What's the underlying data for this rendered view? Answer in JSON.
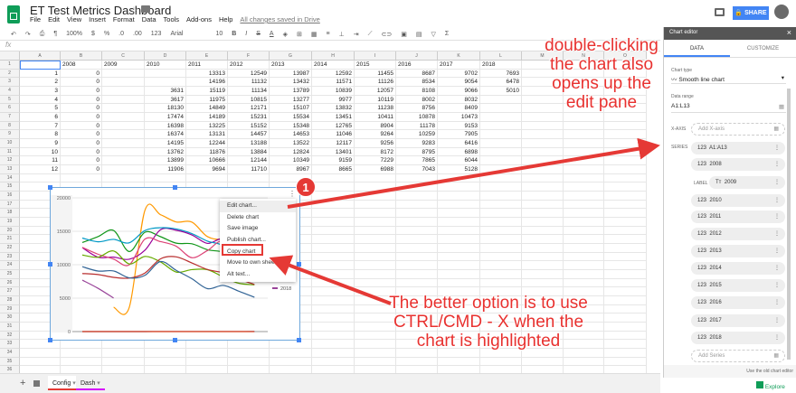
{
  "app": {
    "title": "ET Test Metrics Dashboard",
    "menus": [
      "File",
      "Edit",
      "View",
      "Insert",
      "Format",
      "Data",
      "Tools",
      "Add-ons",
      "Help"
    ],
    "save_status": "All changes saved in Drive",
    "share_label": "SHARE"
  },
  "toolbar": {
    "zoom": "100%",
    "currency": "$",
    "percent": "%",
    "dec_less": ".0",
    "dec_more": ".00",
    "format": "123",
    "font": "Arial",
    "size": "10",
    "bold": "B",
    "italic": "I",
    "strike": "S",
    "text_color": "A",
    "fx": "fx"
  },
  "columns": [
    "A",
    "B",
    "C",
    "D",
    "E",
    "F",
    "G",
    "H",
    "I",
    "J",
    "K",
    "L",
    "M",
    "N",
    "O"
  ],
  "rows": [
    [
      "",
      "2008",
      "2009",
      "2010",
      "2011",
      "2012",
      "2013",
      "2014",
      "2015",
      "2016",
      "2017",
      "2018"
    ],
    [
      "1",
      "0",
      "",
      "",
      "13313",
      "12549",
      "13987",
      "12592",
      "11455",
      "8687",
      "9702",
      "7693"
    ],
    [
      "2",
      "0",
      "",
      "",
      "14196",
      "11132",
      "13432",
      "11571",
      "11126",
      "8534",
      "9054",
      "6478"
    ],
    [
      "3",
      "0",
      "",
      "3631",
      "15119",
      "11134",
      "13789",
      "10839",
      "12057",
      "8108",
      "9066",
      "5010"
    ],
    [
      "4",
      "0",
      "",
      "3617",
      "11975",
      "10815",
      "13277",
      "9977",
      "10119",
      "8002",
      "8032",
      ""
    ],
    [
      "5",
      "0",
      "",
      "18130",
      "14849",
      "12171",
      "15107",
      "13832",
      "11238",
      "8756",
      "8409",
      ""
    ],
    [
      "6",
      "0",
      "",
      "17474",
      "14189",
      "15231",
      "15534",
      "13451",
      "10411",
      "10878",
      "10473",
      ""
    ],
    [
      "7",
      "0",
      "",
      "16398",
      "13225",
      "15152",
      "15348",
      "12765",
      "8904",
      "11178",
      "9153",
      ""
    ],
    [
      "8",
      "0",
      "",
      "16374",
      "13131",
      "14457",
      "14653",
      "11046",
      "9264",
      "10259",
      "7905",
      ""
    ],
    [
      "9",
      "0",
      "",
      "14195",
      "12244",
      "13188",
      "13522",
      "12117",
      "9256",
      "9283",
      "6416",
      ""
    ],
    [
      "10",
      "0",
      "",
      "13762",
      "11876",
      "13884",
      "12824",
      "13401",
      "8172",
      "8795",
      "6898",
      ""
    ],
    [
      "11",
      "0",
      "",
      "13899",
      "10666",
      "12144",
      "10349",
      "9159",
      "7229",
      "7865",
      "6044",
      ""
    ],
    [
      "12",
      "0",
      "",
      "11906",
      "9694",
      "11710",
      "8967",
      "8665",
      "6988",
      "7043",
      "5128",
      ""
    ]
  ],
  "sheets": [
    {
      "name": "Config",
      "color": "#e53935"
    },
    {
      "name": "Dash",
      "color": "#d500f9"
    }
  ],
  "chart_data": {
    "type": "line",
    "smooth": true,
    "x": [
      1,
      2,
      3,
      4,
      5,
      6,
      7,
      8,
      9,
      10,
      11,
      12
    ],
    "ylim": [
      0,
      20000
    ],
    "yticks": [
      "20000",
      "15000",
      "10000",
      "5000",
      "0"
    ],
    "grid": true,
    "series": [
      {
        "name": "A1:A13",
        "color": "#3366cc",
        "values": [
          1,
          2,
          3,
          4,
          5,
          6,
          7,
          8,
          9,
          10,
          11,
          12
        ]
      },
      {
        "name": "2008",
        "color": "#dc3912",
        "values": [
          0,
          0,
          0,
          0,
          0,
          0,
          0,
          0,
          0,
          0,
          0,
          0
        ]
      },
      {
        "name": "2010",
        "color": "#ff9900",
        "values": [
          null,
          null,
          3631,
          3617,
          18130,
          17474,
          16398,
          16374,
          14195,
          13762,
          13899,
          11906
        ]
      },
      {
        "name": "2011",
        "color": "#109618",
        "values": [
          13313,
          14196,
          15119,
          11975,
          14849,
          14189,
          13225,
          13131,
          12244,
          11876,
          10666,
          9694
        ]
      },
      {
        "name": "2012",
        "color": "#990099",
        "values": [
          12549,
          11132,
          11134,
          10815,
          12171,
          15231,
          15152,
          14457,
          13188,
          13884,
          12144,
          11710
        ]
      },
      {
        "name": "2013",
        "color": "#0099c6",
        "values": [
          13987,
          13432,
          13789,
          13277,
          15107,
          15534,
          15348,
          14653,
          13522,
          12824,
          10349,
          8967
        ]
      },
      {
        "name": "2014",
        "color": "#dd4477",
        "values": [
          12592,
          11571,
          10839,
          9977,
          13832,
          13451,
          12765,
          11046,
          12117,
          13401,
          9159,
          8665
        ]
      },
      {
        "name": "2015",
        "color": "#66aa00",
        "values": [
          11455,
          11126,
          12057,
          10119,
          11238,
          10411,
          8904,
          9264,
          9256,
          8172,
          7229,
          6988
        ]
      },
      {
        "name": "2016",
        "color": "#b82e2e",
        "values": [
          8687,
          8534,
          8108,
          8002,
          8756,
          10878,
          11178,
          10259,
          9283,
          8795,
          7865,
          7043
        ]
      },
      {
        "name": "2017",
        "color": "#316395",
        "values": [
          9702,
          9054,
          9066,
          8032,
          8409,
          10473,
          9153,
          7905,
          6416,
          6898,
          6044,
          5128
        ]
      },
      {
        "name": "2018",
        "color": "#994499",
        "values": [
          7693,
          6478,
          5010,
          null,
          null,
          null,
          null,
          null,
          null,
          null,
          null,
          null
        ]
      }
    ],
    "legend_visible": "2018"
  },
  "context_menu": [
    "Edit chart...",
    "Delete chart",
    "Save image",
    "Publish chart...",
    "Copy chart",
    "Move to own sheet",
    "Alt text..."
  ],
  "badge": "1",
  "editor": {
    "title": "Chart editor",
    "tabs": [
      "DATA",
      "CUSTOMIZE"
    ],
    "chart_type_label": "Chart type",
    "chart_type": "Smooth line chart",
    "data_range_label": "Data range",
    "data_range": "A1:L13",
    "xaxis_label": "X-AXIS",
    "xaxis_placeholder": "Add X-axis",
    "series_label": "SERIES",
    "label_label": "LABEL",
    "series": [
      "A1:A13",
      "2008",
      "2010",
      "2011",
      "2012",
      "2013",
      "2014",
      "2015",
      "2016",
      "2017",
      "2018"
    ],
    "label_series": "2009",
    "num_icon": "123",
    "text_icon": "Tт",
    "add_series": "Add Series",
    "old_editor": "Use the old chart editor",
    "explore": "Explore"
  },
  "annotations": {
    "top": "double-clicking the chart also opens up the edit pane",
    "bottom": "The better option is to use CTRL/CMD - X when the chart is highlighted"
  }
}
